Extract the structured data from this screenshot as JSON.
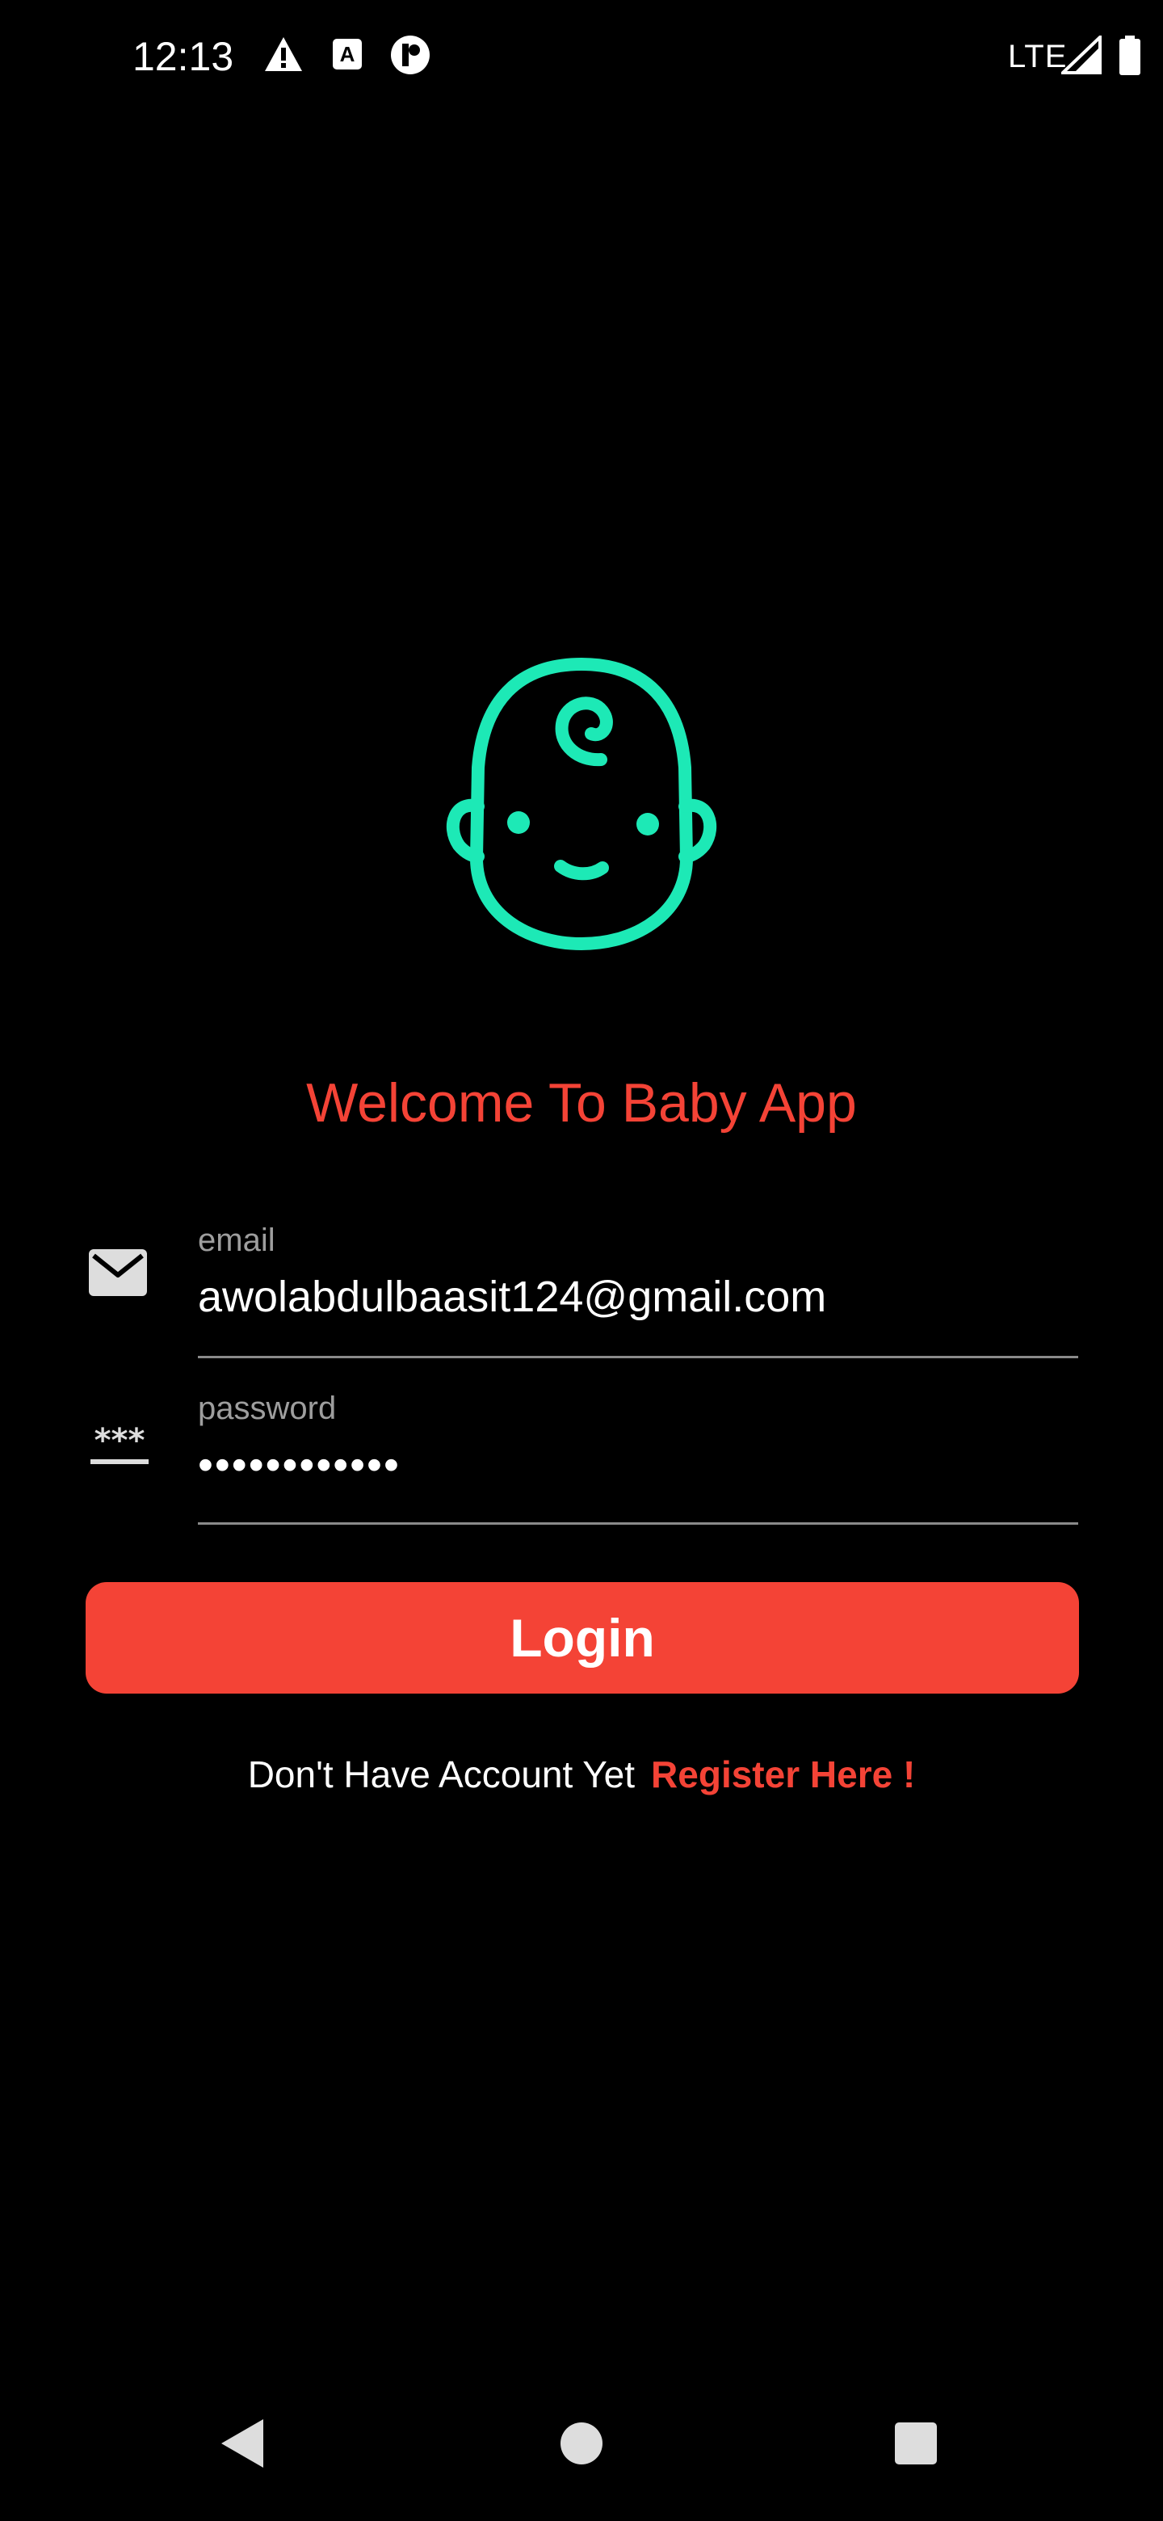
{
  "status_bar": {
    "time": "12:13",
    "network": "LTE",
    "icons": [
      "alert-icon",
      "a-icon",
      "p-icon",
      "signal-icon",
      "battery-icon"
    ]
  },
  "colors": {
    "background": "#000000",
    "accent": "#f44336",
    "logo": "#1de9b6",
    "label": "#9e9e9e",
    "underline": "#8a8a8a"
  },
  "logo": {
    "icon": "baby-face-icon"
  },
  "title": "Welcome To Baby App",
  "form": {
    "email": {
      "label": "email",
      "value": "awolabdulbaasit124@gmail.com",
      "icon": "envelope-icon"
    },
    "password": {
      "label": "password",
      "value": "••••••••••••",
      "icon": "password-icon"
    },
    "login_label": "Login"
  },
  "register": {
    "prompt": "Don't Have Account Yet",
    "link": "Register Here !"
  },
  "nav_bar": {
    "icons": [
      "back-icon",
      "home-icon",
      "recents-icon"
    ]
  }
}
